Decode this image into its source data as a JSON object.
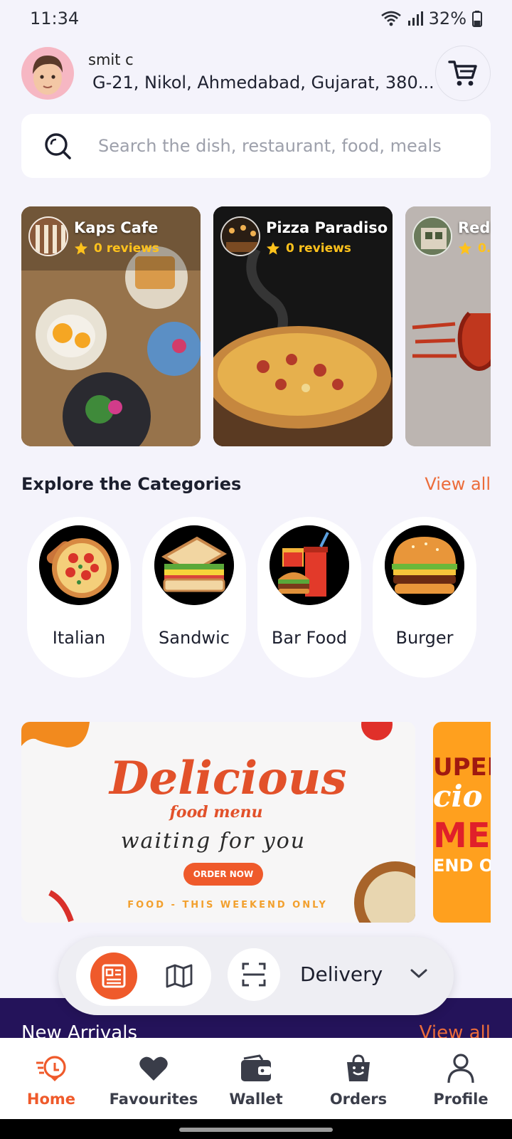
{
  "status_bar": {
    "time": "11:34",
    "battery": "32%"
  },
  "header": {
    "user_name": "smit c",
    "address": "G-21, Nikol, Ahmedabad, Gujarat, 380..."
  },
  "search": {
    "placeholder": "Search the dish, restaurant, food, meals"
  },
  "restaurants": [
    {
      "name": "Kaps Cafe",
      "reviews": "0 reviews"
    },
    {
      "name": "Pizza Paradiso",
      "reviews": "0 reviews"
    },
    {
      "name": "Red",
      "reviews": "0..."
    }
  ],
  "categories_section": {
    "title": "Explore the Categories",
    "view_all": "View all",
    "items": [
      {
        "label": "Italian"
      },
      {
        "label": "Sandwic"
      },
      {
        "label": "Bar Food"
      },
      {
        "label": "Burger"
      }
    ]
  },
  "banners": [
    {
      "headline": "Delicious",
      "subhead": "food menu",
      "tagline": "waiting for you",
      "button": "ORDER NOW",
      "footer": "FOOD - THIS WEEKEND ONLY"
    },
    {
      "line1": "UPER",
      "line2": "cio",
      "line3": "MEN",
      "line4": "END O"
    }
  ],
  "new_arrivals": {
    "title": "New Arrivals",
    "view_all": "View all"
  },
  "mode_bar": {
    "delivery_label": "Delivery"
  },
  "bottom_nav": [
    {
      "label": "Home",
      "icon": "home-delivery-icon",
      "active": true
    },
    {
      "label": "Favourites",
      "icon": "heart-icon",
      "active": false
    },
    {
      "label": "Wallet",
      "icon": "wallet-icon",
      "active": false
    },
    {
      "label": "Orders",
      "icon": "shopping-bag-icon",
      "active": false
    },
    {
      "label": "Profile",
      "icon": "person-icon",
      "active": false
    }
  ],
  "colors": {
    "accent": "#ef5a2b",
    "background": "#f4f3fb",
    "dark_band": "#24135a",
    "star": "#ffc21c"
  }
}
